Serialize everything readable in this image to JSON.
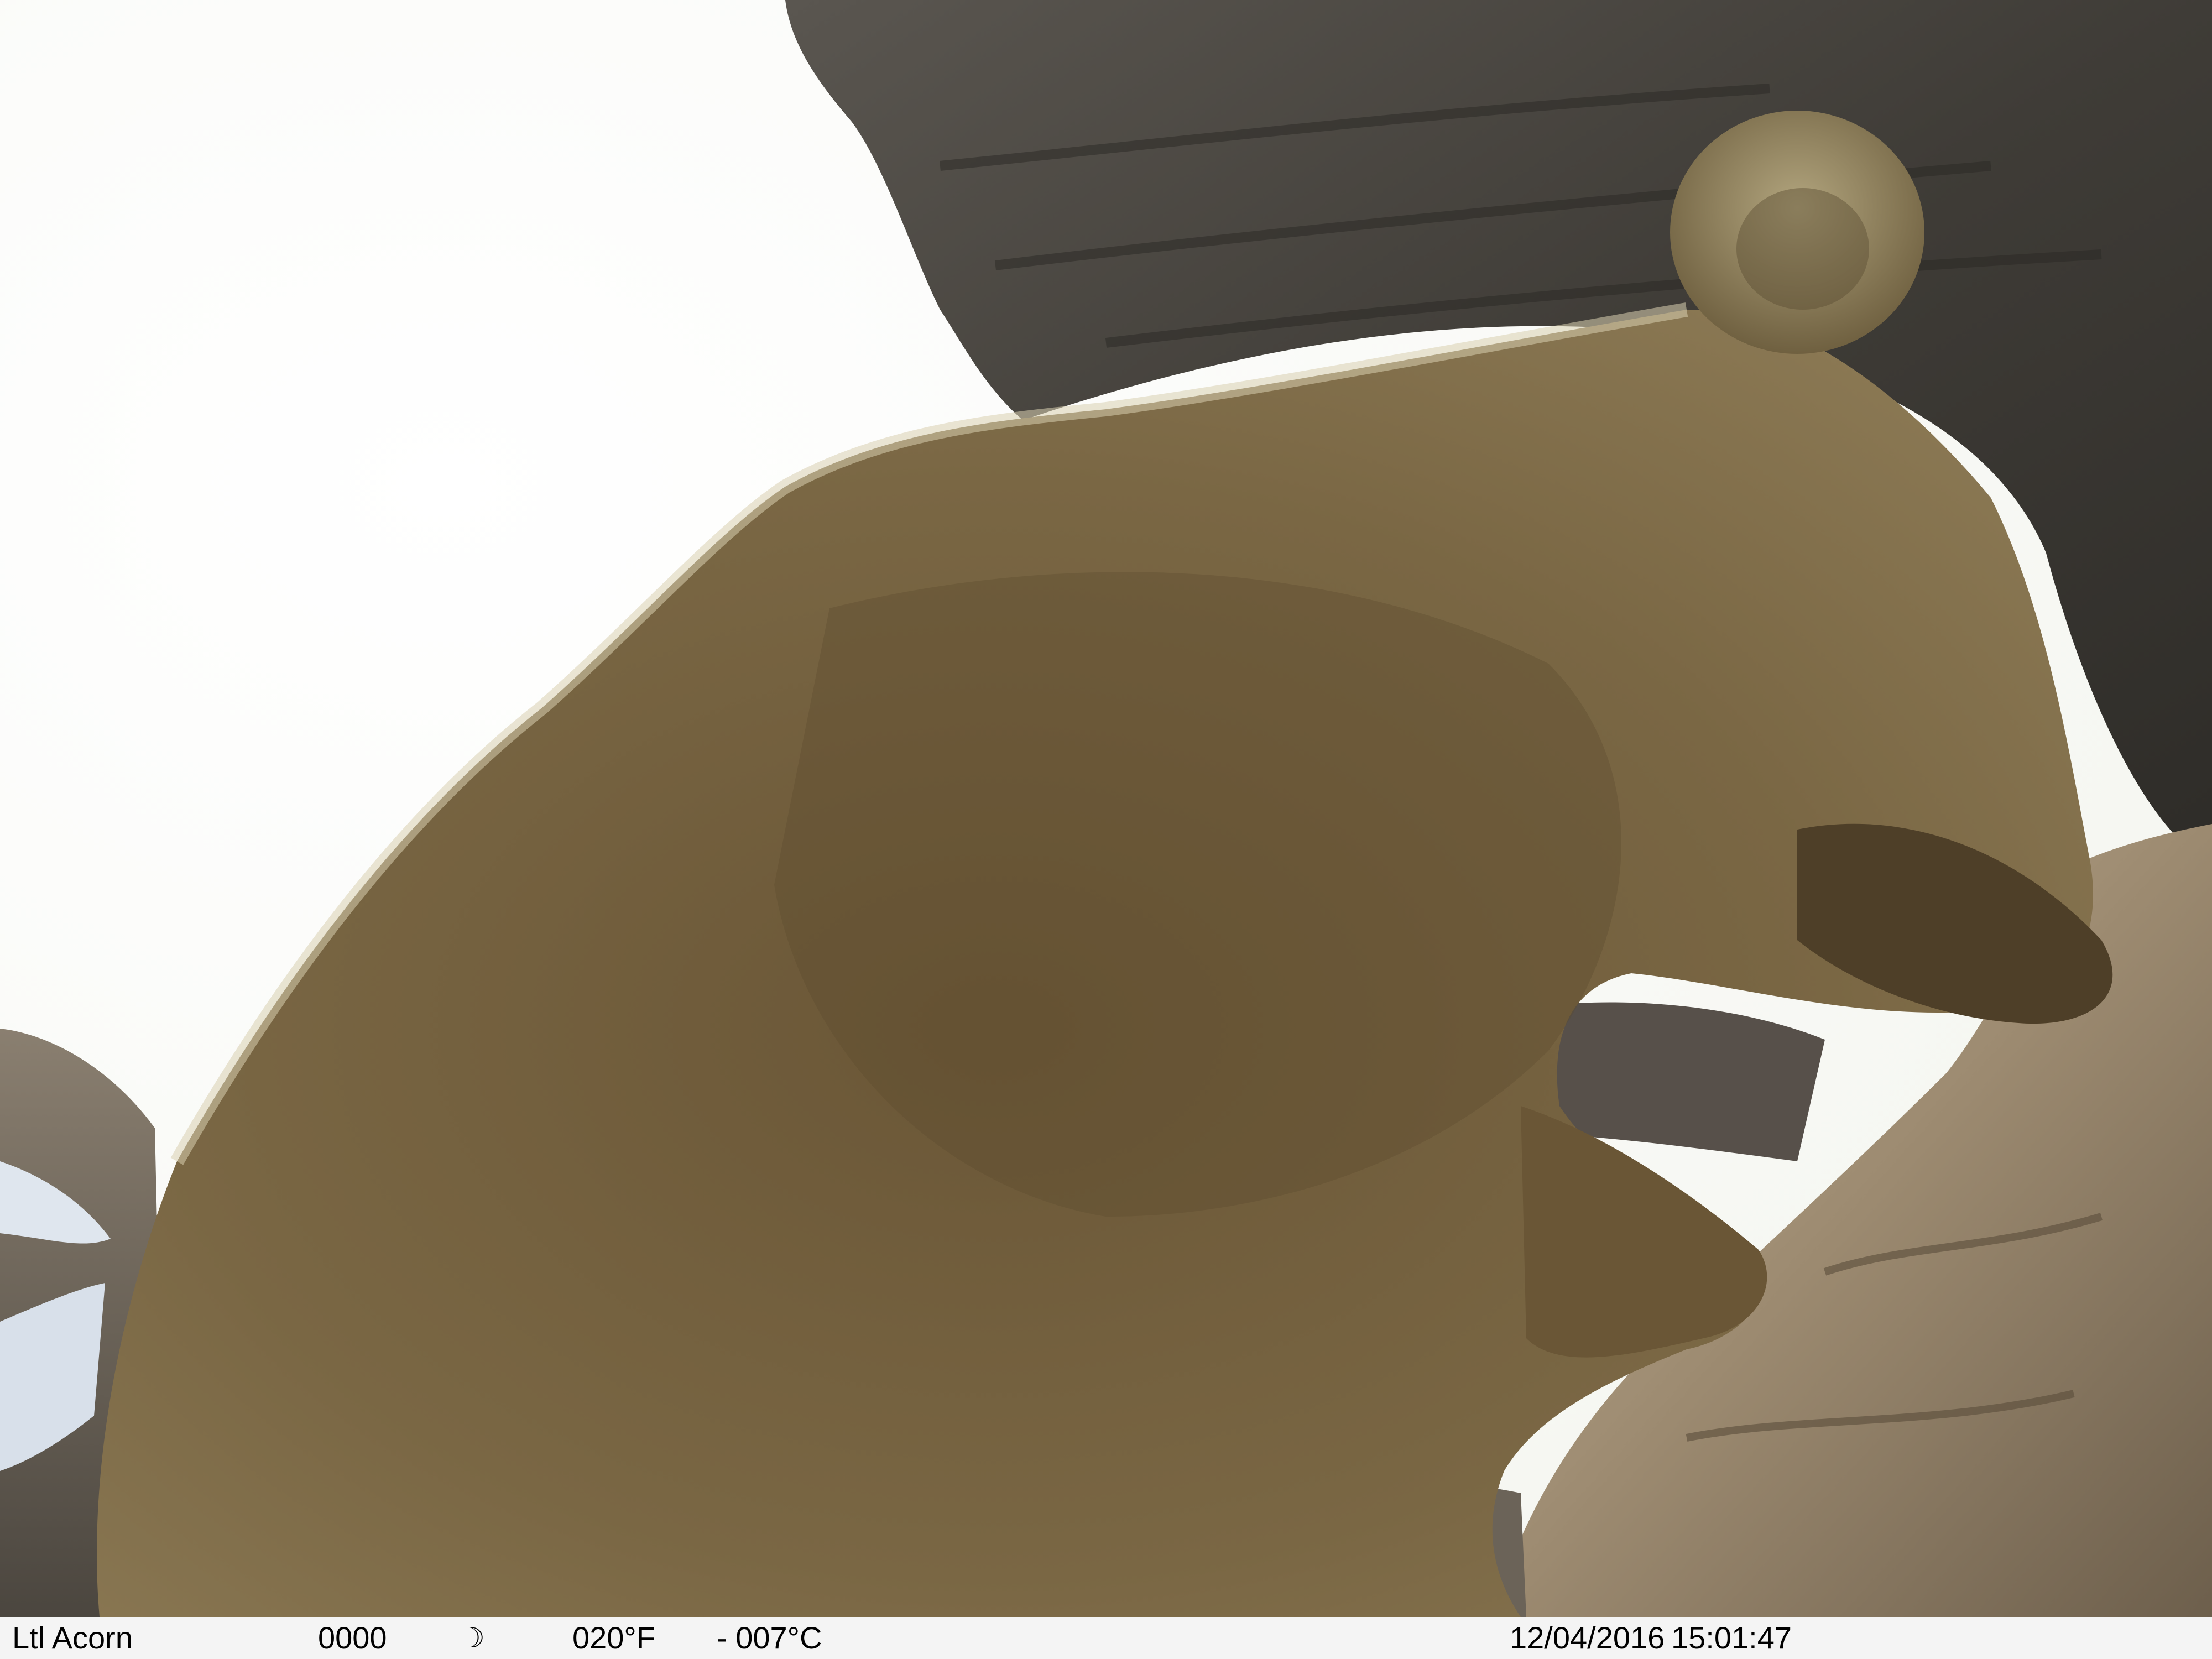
{
  "photo": {
    "subject": "bear",
    "setting": "rocky cliff ledge against bright sky"
  },
  "info_bar": {
    "camera_name": "Ltl Acorn",
    "frame_number": "0000",
    "moon_icon": "moon-phase-icon",
    "moon_glyph": "☽",
    "temp_f": "020°F",
    "temp_c": "- 007°C",
    "date": "12/04/2016",
    "time": "15:01:47"
  }
}
